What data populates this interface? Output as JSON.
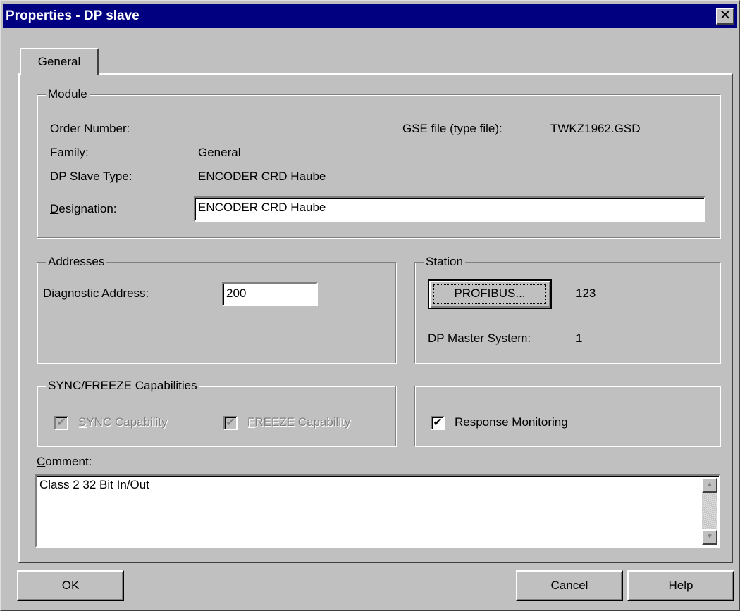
{
  "window": {
    "title": "Properties - DP slave",
    "close_glyph": "✕"
  },
  "tabs": [
    {
      "label": "General"
    }
  ],
  "module": {
    "group_title": "Module",
    "order_number_label": "Order Number:",
    "order_number_value": "",
    "gse_file_label": "GSE file (type file):",
    "gse_file_value": "TWKZ1962.GSD",
    "family_label": "Family:",
    "family_value": "General",
    "dp_slave_type_label": "DP Slave Type:",
    "dp_slave_type_value": "ENCODER CRD Haube",
    "designation_label": "Designation:",
    "designation_value": "ENCODER CRD Haube"
  },
  "addresses": {
    "group_title": "Addresses",
    "diagnostic_address_label": "Diagnostic Address:",
    "diagnostic_address_value": "200"
  },
  "station": {
    "group_title": "Station",
    "profibus_button_label": "PROFIBUS...",
    "profibus_address": "123",
    "dp_master_system_label": "DP Master System:",
    "dp_master_system_value": "1"
  },
  "sync_freeze": {
    "group_title": "SYNC/FREEZE Capabilities",
    "sync_label": "SYNC Capability",
    "sync_checked": true,
    "sync_enabled": false,
    "freeze_label": "FREEZE Capability",
    "freeze_checked": true,
    "freeze_enabled": false
  },
  "response_monitoring": {
    "label": "Response Monitoring",
    "checked": true
  },
  "comment": {
    "label": "Comment:",
    "value": "Class 2  32 Bit In/Out"
  },
  "buttons": {
    "ok": "OK",
    "cancel": "Cancel",
    "help": "Help"
  }
}
